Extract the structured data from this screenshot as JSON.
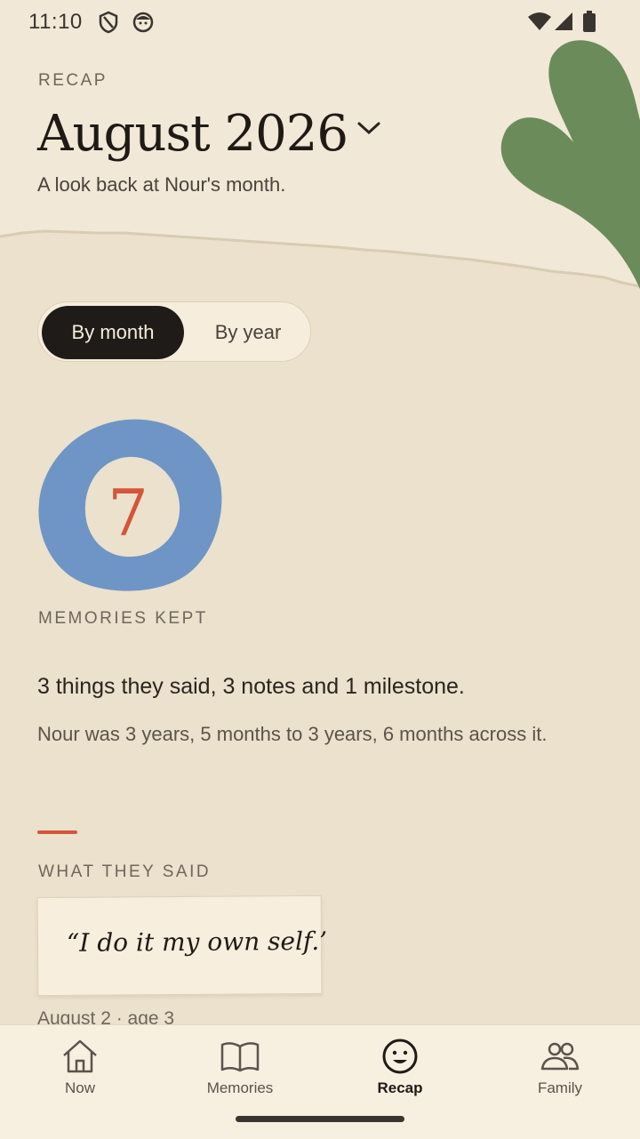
{
  "status": {
    "time": "11:10"
  },
  "header": {
    "eyebrow": "RECAP",
    "title": "August 2026",
    "subtitle": "A look back at Nour's month."
  },
  "toggle": {
    "options": [
      "By month",
      "By year"
    ],
    "selected": "By month"
  },
  "stats": {
    "memories_count": "7",
    "memories_label": "MEMORIES KEPT",
    "summary": "3 things they said, 3 notes and 1 milestone.",
    "age_range": "Nour was 3 years, 5 months to 3 years, 6 months across it."
  },
  "said": {
    "heading": "WHAT THEY SAID",
    "quote": "“I do it my own self.’",
    "meta": "August 2 · age 3"
  },
  "nav": {
    "items": [
      {
        "label": "Now",
        "icon": "home-icon"
      },
      {
        "label": "Memories",
        "icon": "book-icon"
      },
      {
        "label": "Recap",
        "icon": "smiley-icon"
      },
      {
        "label": "Family",
        "icon": "people-icon"
      }
    ],
    "active": "Recap"
  },
  "colors": {
    "background": "#ebe1cc",
    "paper": "#f1e8d7",
    "accent": "#d4553a",
    "blob": "#6f95c6",
    "leaf": "#6b8c5a",
    "dark": "#1f1b18"
  }
}
